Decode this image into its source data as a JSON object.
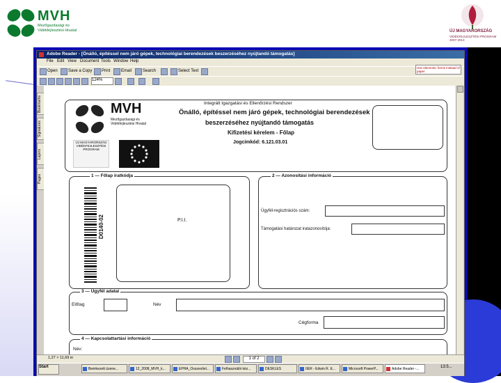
{
  "slide": {
    "header_logo_text": "MVH",
    "header_logo_sub": "Mezőgazdasági és Vidékfejlesztési Hivatal",
    "eu_logo_title": "ÚJ MAGYARORSZÁG",
    "eu_logo_sub": "VIDÉKFEJLESZTÉSI PROGRAM 2007-2013"
  },
  "app": {
    "title": "Adobe Reader - [Önálló, építéssel nem járó gépek, technológiai berendezések beszerzéséhez nyújtandó támogatás]",
    "menu": [
      "File",
      "Edit",
      "View",
      "Document",
      "Tools",
      "Window",
      "Help"
    ],
    "toolbar1": {
      "open": "Open",
      "save_copy": "Save a Copy",
      "print": "Print",
      "email": "Email",
      "search": "Search",
      "select_text": "Select Text"
    },
    "help_text": "Use electronic forms instead of paper",
    "zoom": "124%",
    "nav_tabs": [
      "Bookmarks",
      "Signatures",
      "Layers",
      "Pages"
    ],
    "status": {
      "dimensions": "1,27 × 11,69 in",
      "page": "1 of 2"
    }
  },
  "form": {
    "logo_text": "MVH",
    "logo_sub": "Mezőgazdasági és Vidékfejlesztési Hivatal",
    "eu_seal": "ÚJ MAGYARORSZÁG VIDÉKFEJLESZTÉSI PROGRAM",
    "system_name": "Integrált Igazgatási és Ellenőrzési Rendszer",
    "title_line1": "Önálló, építéssel nem járó gépek, technológiai berendezések",
    "title_line2": "beszerzéséhez nyújtandó támogatás",
    "title_line3": "Kifizetési kérelem - Főlap",
    "code": "Jogcímkód: 6.121.03.01",
    "sec1_label": "1 — Főlap iratkódja",
    "sec2_label": "2 — Azonosítási információ",
    "barcode_text": "D0140-02",
    "pu_text": "P.I.I.",
    "reg_label": "Ügyfél-regisztrációs szám:",
    "decision_label": "Támogatási határozat iratazonosítója:",
    "sec3_label": "3 — Ügyfél adatai",
    "eloltag": "Előtag",
    "nev": "Név",
    "cegforma": "Cégforma",
    "sec4_label": "4 — Kapcsolattartási információ",
    "nev2": "Név:"
  },
  "taskbar": {
    "start": "Start",
    "tasks": [
      "Beérkezett üzene...",
      "12_2008_MVH_k...",
      "EPHA_Osszesítel...",
      "Felhasználói kéz...",
      "DESKLES",
      "IIER - Edwin R. E...",
      "Microsoft PowerP...",
      "Adobe Reader -..."
    ],
    "clock": "13:5..."
  }
}
